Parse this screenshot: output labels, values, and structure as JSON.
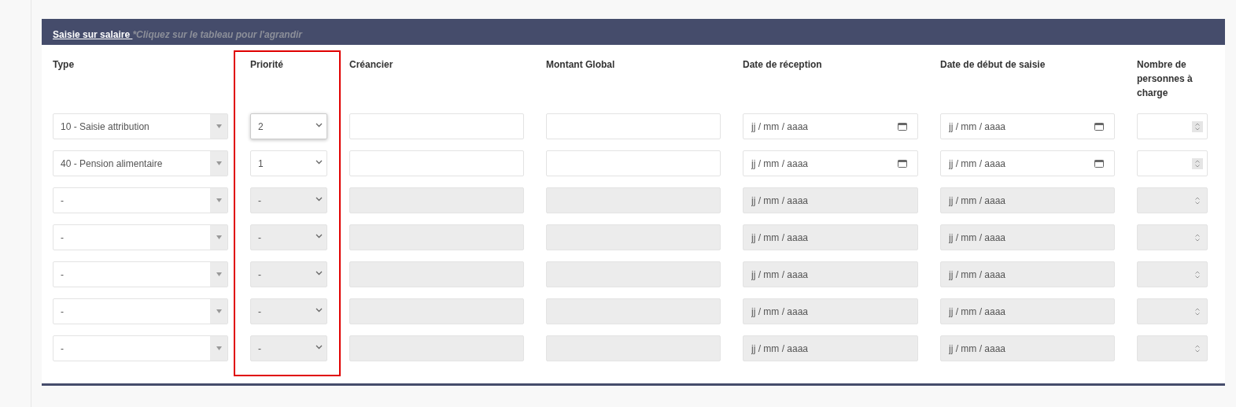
{
  "panel": {
    "title": "Saisie sur salaire ",
    "hint": "*Cliquez sur le tableau pour l'agrandir"
  },
  "columns": [
    {
      "label": "Type",
      "highlighted": false
    },
    {
      "label": "Priorité",
      "highlighted": true
    },
    {
      "label": "Créancier",
      "highlighted": false
    },
    {
      "label": "Montant Global",
      "highlighted": false
    },
    {
      "label": "Date de réception",
      "highlighted": false
    },
    {
      "label": "Date de début de saisie",
      "highlighted": false
    },
    {
      "label": "Nombre de personnes à charge",
      "highlighted": false
    }
  ],
  "rows": [
    {
      "type": "10 - Saisie attribution",
      "priority": "2",
      "focused": true,
      "disabled": false,
      "reception_placeholder": "jj / mm / aaaa",
      "debut_placeholder": "jj / mm / aaaa"
    },
    {
      "type": "40 - Pension alimentaire",
      "priority": "1",
      "focused": false,
      "disabled": false,
      "reception_placeholder": "jj / mm / aaaa",
      "debut_placeholder": "jj / mm / aaaa"
    },
    {
      "type": "-",
      "priority": "-",
      "focused": false,
      "disabled": true,
      "reception_placeholder": "jj / mm / aaaa",
      "debut_placeholder": "jj / mm / aaaa"
    },
    {
      "type": "-",
      "priority": "-",
      "focused": false,
      "disabled": true,
      "reception_placeholder": "jj / mm / aaaa",
      "debut_placeholder": "jj / mm / aaaa"
    },
    {
      "type": "-",
      "priority": "-",
      "focused": false,
      "disabled": true,
      "reception_placeholder": "jj / mm / aaaa",
      "debut_placeholder": "jj / mm / aaaa"
    },
    {
      "type": "-",
      "priority": "-",
      "focused": false,
      "disabled": true,
      "reception_placeholder": "jj / mm / aaaa",
      "debut_placeholder": "jj / mm / aaaa"
    },
    {
      "type": "-",
      "priority": "-",
      "focused": false,
      "disabled": true,
      "reception_placeholder": "jj / mm / aaaa",
      "debut_placeholder": "jj / mm / aaaa"
    }
  ]
}
